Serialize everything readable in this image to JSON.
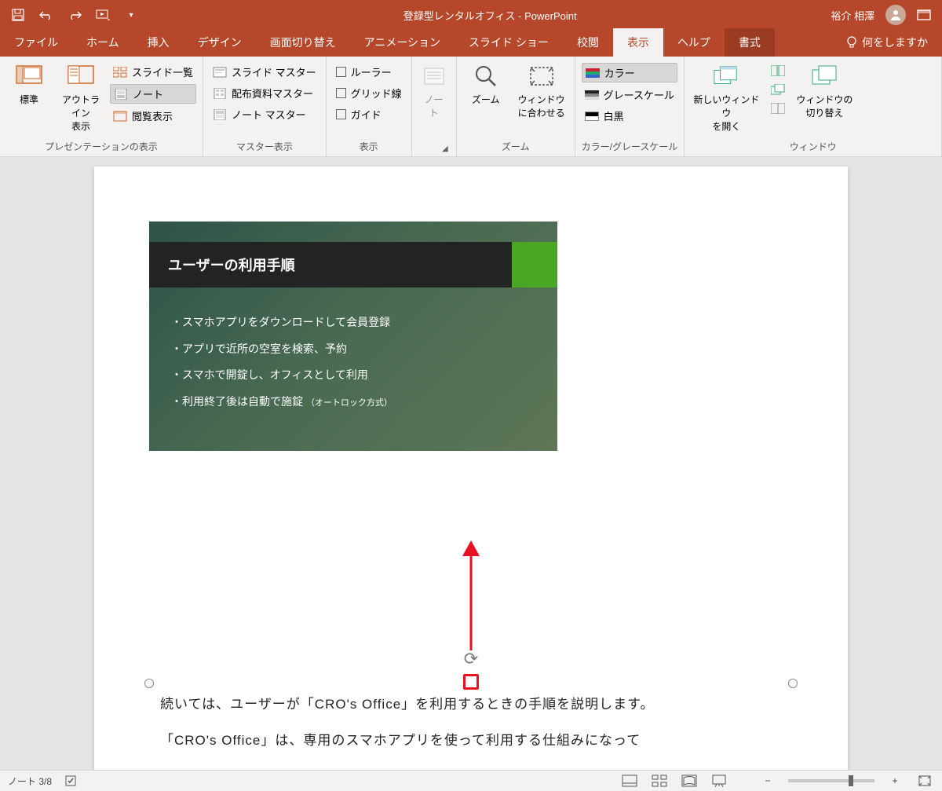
{
  "titlebar": {
    "doc_title": "登録型レンタルオフィス - PowerPoint",
    "user_name": "裕介 相澤"
  },
  "tabs": {
    "file": "ファイル",
    "home": "ホーム",
    "insert": "挿入",
    "design": "デザイン",
    "transitions": "画面切り替え",
    "animations": "アニメーション",
    "slideshow": "スライド ショー",
    "review": "校閲",
    "view": "表示",
    "help": "ヘルプ",
    "format": "書式",
    "tell_me": "何をしますか"
  },
  "ribbon": {
    "g1": {
      "label": "プレゼンテーションの表示",
      "normal": "標準",
      "outline": "アウトライン\n表示",
      "slide_sorter": "スライド一覧",
      "notes": "ノート",
      "reading": "閲覧表示"
    },
    "g2": {
      "label": "マスター表示",
      "slide_master": "スライド マスター",
      "handout_master": "配布資料マスター",
      "notes_master": "ノート マスター"
    },
    "g3": {
      "label": "表示",
      "ruler": "ルーラー",
      "gridlines": "グリッド線",
      "guides": "ガイド"
    },
    "g4": {
      "label": "",
      "notes_btn": "ノー\nト"
    },
    "g5": {
      "label": "ズーム",
      "zoom": "ズーム",
      "fit": "ウィンドウ\nに合わせる"
    },
    "g6": {
      "label": "カラー/グレースケール",
      "color": "カラー",
      "grayscale": "グレースケール",
      "bw": "白黒"
    },
    "g7": {
      "label": "ウィンドウ",
      "new_window": "新しいウィンドウ\nを開く",
      "switch": "ウィンドウの\n切り替え"
    }
  },
  "slide": {
    "title": "ユーザーの利用手順",
    "b1": "スマホアプリをダウンロードして会員登録",
    "b2": "アプリで近所の空室を検索、予約",
    "b3": "スマホで開錠し、オフィスとして利用",
    "b4": "利用終了後は自動で施錠",
    "b4_note": "（オートロック方式）"
  },
  "notes": {
    "line1": "続いては、ユーザーが「CRO's Office」を利用するときの手順を説明します。",
    "line2": "「CRO's Office」は、専用のスマホアプリを使って利用する仕組みになって"
  },
  "status": {
    "page": "ノート 3/8"
  }
}
